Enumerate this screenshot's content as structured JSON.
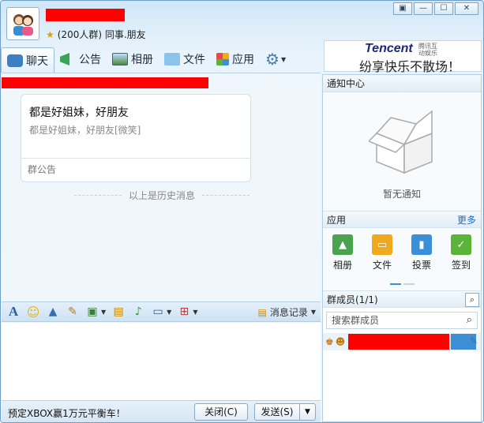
{
  "header": {
    "group_name": "",
    "member_info": "(200人群) 同事.朋友"
  },
  "window_controls": [
    "▣",
    "—",
    "☐",
    "✕"
  ],
  "tabs": [
    {
      "label": "聊天",
      "icon": "chat-icon"
    },
    {
      "label": "公告",
      "icon": "megaphone-icon"
    },
    {
      "label": "相册",
      "icon": "album-icon"
    },
    {
      "label": "文件",
      "icon": "folder-icon"
    },
    {
      "label": "应用",
      "icon": "apps-icon"
    }
  ],
  "banner": {
    "brand": "Tencent",
    "brand_sub": "腾讯互动娱乐",
    "tagline": "纷享快乐不散场！"
  },
  "notice": {
    "title": "都是好姐妹，好朋友",
    "body": "都是好姐妹，好朋友[微笑]",
    "footer": "群公告"
  },
  "history_divider": "以上是历史消息",
  "input_toolbar": {
    "history_label": "消息记录"
  },
  "bottom": {
    "promo": "预定XBOX赢1万元平衡车！",
    "close_label": "关闭(C)",
    "send_label": "发送(S)"
  },
  "right_panel": {
    "notify_title": "通知中心",
    "notify_empty": "暂无通知",
    "apps_title": "应用",
    "more_label": "更多",
    "apps": [
      {
        "label": "相册",
        "icon": "album-icon",
        "color": "#4aa34f"
      },
      {
        "label": "文件",
        "icon": "folder-icon",
        "color": "#f0a81c"
      },
      {
        "label": "投票",
        "icon": "vote-icon",
        "color": "#3b8fd8"
      },
      {
        "label": "签到",
        "icon": "checkin-icon",
        "color": "#5bb43a"
      }
    ],
    "members_title": "群成员(1/1)",
    "member_search_placeholder": "搜索群成员"
  },
  "colors": {
    "accent": "#3d8fd5",
    "redaction": "#ff0000"
  }
}
